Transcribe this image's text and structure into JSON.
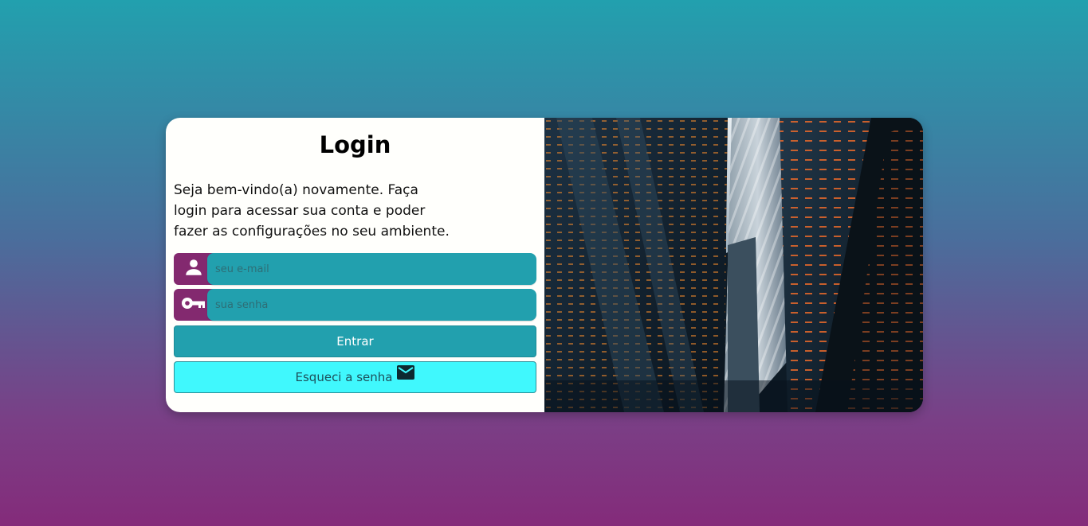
{
  "login": {
    "title": "Login",
    "welcome_text": "Seja bem-vindo(a) novamente. Faça login para acessar sua conta e poder fazer as configurações no seu ambiente.",
    "email_placeholder": "seu e-mail",
    "password_placeholder": "sua senha",
    "submit_label": "Entrar",
    "forgot_label": "Esqueci a senha"
  },
  "icons": {
    "email_field_icon": "person-icon",
    "password_field_icon": "key-icon",
    "forgot_icon": "mail-icon"
  },
  "colors": {
    "accent_purple": "#83296f",
    "accent_teal": "#22a0ae",
    "forgot_cyan": "#40f8fd",
    "card_background": "#fffffc"
  }
}
